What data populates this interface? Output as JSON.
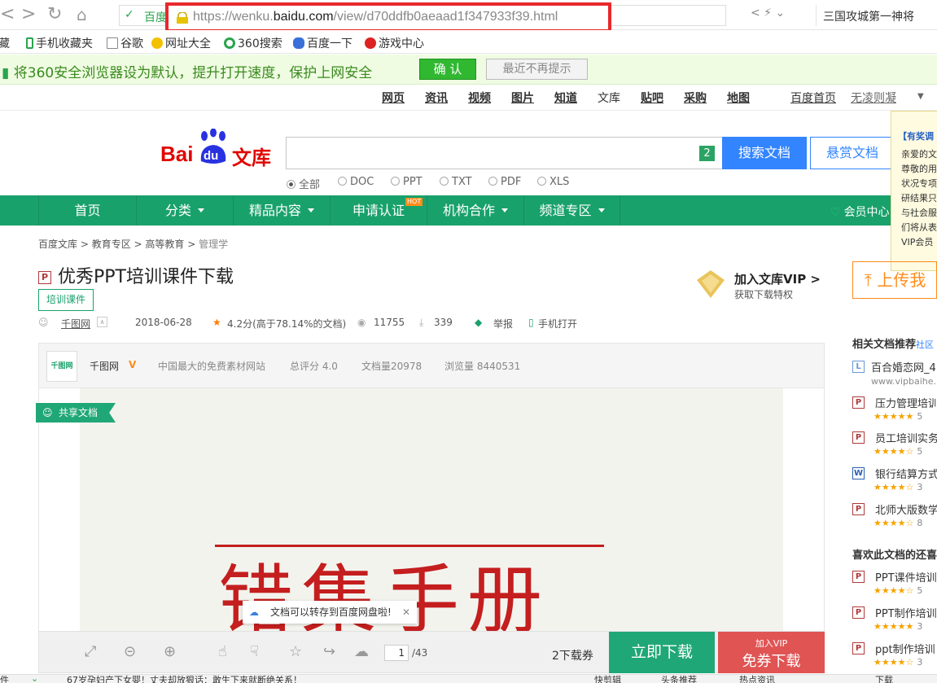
{
  "browser": {
    "site_label": "百度",
    "url_prefix": "https://wenku.",
    "url_domain": "baidu.com",
    "url_path": "/view/d70ddfb0aeaad1f347933f39.html",
    "hot_search": "三国攻城第一神将"
  },
  "bookmarks": [
    {
      "label": "藏"
    },
    {
      "label": "手机收藏夹"
    },
    {
      "label": "谷歌"
    },
    {
      "label": "网址大全"
    },
    {
      "label": "360搜索"
    },
    {
      "label": "百度一下"
    },
    {
      "label": "游戏中心"
    }
  ],
  "default_bar": {
    "message": "将360安全浏览器设为默认，提升打开速度，保护上网安全",
    "confirm": "确 认",
    "never": "最近不再提示"
  },
  "baidu_nav": {
    "links": [
      "网页",
      "资讯",
      "视频",
      "图片",
      "知道",
      "文库",
      "贴吧",
      "采购",
      "地图"
    ],
    "home": "百度首页",
    "user": "无凌则凝"
  },
  "logo": {
    "part1": "Bai",
    "part2": "du",
    "part3": "文库"
  },
  "search": {
    "badge": "2",
    "button": "搜索文档",
    "reward": "悬赏文档",
    "filetypes": [
      "全部",
      "DOC",
      "PPT",
      "TXT",
      "PDF",
      "XLS"
    ]
  },
  "promo_popup": {
    "title": "【有奖调",
    "lines": [
      "亲爱的文",
      "尊敬的用",
      "状况专项",
      "研结果只",
      "与社会服",
      "们将从表",
      "VIP会员"
    ]
  },
  "green_nav": {
    "items": [
      {
        "label": "首页"
      },
      {
        "label": "分类"
      },
      {
        "label": "精品内容"
      },
      {
        "label": "申请认证"
      },
      {
        "label": "机构合作"
      },
      {
        "label": "频道专区"
      }
    ],
    "hot": "HOT",
    "vip_center": "会员中心"
  },
  "breadcrumb": [
    "百度文库",
    "教育专区",
    "高等教育",
    "管理学"
  ],
  "doc": {
    "type_icon": "P",
    "title": "优秀PPT培训课件下载",
    "tag": "培训课件",
    "author": "千图网",
    "date": "2018-06-28",
    "rating": "4.2分(高于78.14%的文档)",
    "views": "11755",
    "downloads": "339",
    "report": "举报",
    "mobile": "手机打开"
  },
  "vip": {
    "title": "加入文库VIP >",
    "subtitle": "获取下载特权"
  },
  "upload": "上传我",
  "author_bar": {
    "logo_text": "千图网",
    "name": "千图网",
    "desc": "中国最大的免费素材网站",
    "score": "总评分 4.0",
    "doc_count": "文档量20978",
    "views": "浏览量 8440531"
  },
  "preview": {
    "shared_tag": "共享文档",
    "big_text": "错集手册",
    "toast": "文档可以转存到百度网盘啦!"
  },
  "toolbar": {
    "page": "1",
    "total": "/43",
    "coupon": "2下载券",
    "download": "立即下载",
    "free_small": "加入VIP",
    "free_big": "免券下载"
  },
  "sidebar": {
    "related_title": "相关文档推荐",
    "related_more": "社区",
    "related": [
      {
        "icon": "L",
        "name": "百合婚恋网_4",
        "url": "www.vipbaihe."
      },
      {
        "icon": "P",
        "name": "压力管理培训",
        "stars": "★★★★★",
        "count": "5"
      },
      {
        "icon": "P",
        "name": "员工培训实务",
        "stars": "★★★★☆",
        "count": "5"
      },
      {
        "icon": "W",
        "name": "银行结算方式",
        "stars": "★★★★☆",
        "count": "3"
      },
      {
        "icon": "P",
        "name": "北师大版数学",
        "stars": "★★★★☆",
        "count": "8"
      }
    ],
    "like_title": "喜欢此文档的还喜",
    "like": [
      {
        "icon": "P",
        "name": "PPT课件培训",
        "stars": "★★★★☆",
        "count": "5"
      },
      {
        "icon": "P",
        "name": "PPT制作培训",
        "stars": "★★★★★",
        "count": "3"
      },
      {
        "icon": "P",
        "name": "ppt制作培训",
        "stars": "★★★★☆",
        "count": "3"
      }
    ]
  },
  "statusbar": {
    "left": "件",
    "news": "67岁孕妇产下女婴！丈夫却放狠话：敢生下来就断绝关系！",
    "items": [
      "快剪辑",
      "头条推荐",
      "热点资讯",
      "下载"
    ]
  },
  "colors": {
    "accent_green": "#19a16b",
    "baidu_blue": "#3385ff",
    "highlight_red": "#e8282b"
  }
}
